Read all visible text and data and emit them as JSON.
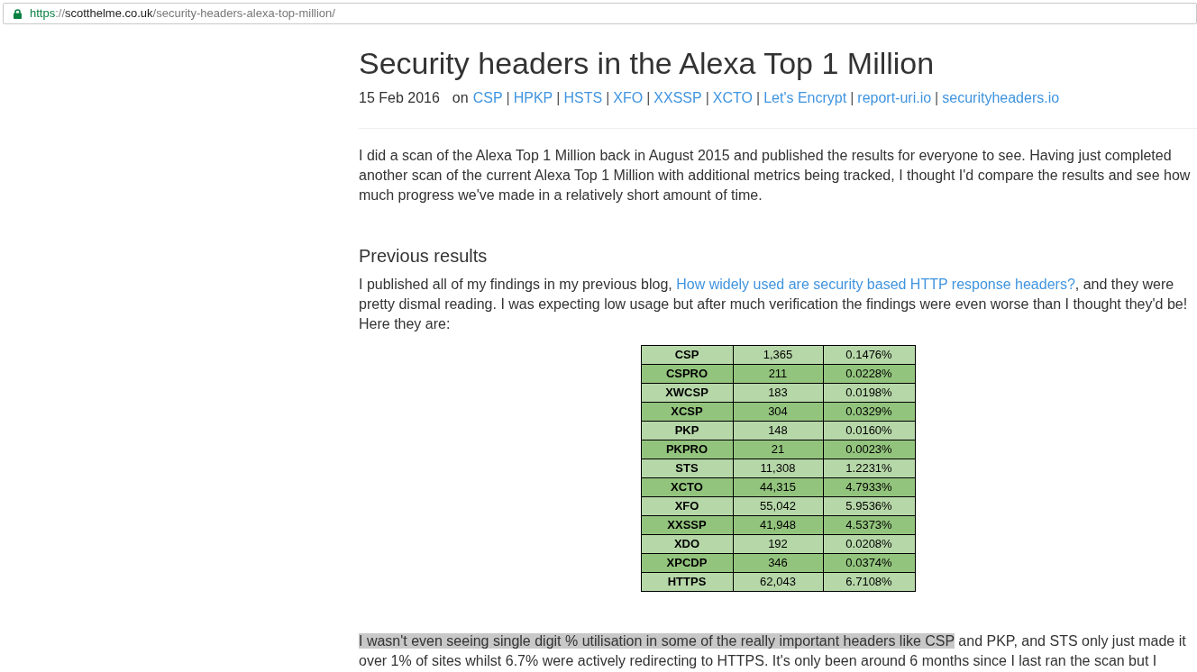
{
  "address_bar": {
    "scheme": "https",
    "separator": "://",
    "host": "scotthelme.co.uk",
    "path": "/security-headers-alexa-top-million/"
  },
  "article": {
    "title": "Security headers in the Alexa Top 1 Million",
    "meta": [
      {
        "kind": "date",
        "text": "15 Feb 2016"
      },
      {
        "kind": "text",
        "text": "on"
      },
      {
        "kind": "link",
        "text": "CSP"
      },
      {
        "kind": "separator",
        "text": "|"
      },
      {
        "kind": "link",
        "text": "HPKP"
      },
      {
        "kind": "separator",
        "text": "|"
      },
      {
        "kind": "link",
        "text": "HSTS"
      },
      {
        "kind": "separator",
        "text": "|"
      },
      {
        "kind": "link",
        "text": "XFO"
      },
      {
        "kind": "separator",
        "text": "|"
      },
      {
        "kind": "link",
        "text": "XXSSP"
      },
      {
        "kind": "separator",
        "text": "|"
      },
      {
        "kind": "link",
        "text": "XCTO"
      },
      {
        "kind": "separator",
        "text": "|"
      },
      {
        "kind": "link",
        "text": "Let's Encrypt"
      },
      {
        "kind": "separator",
        "text": "|"
      },
      {
        "kind": "link",
        "text": "report-uri.io"
      },
      {
        "kind": "separator",
        "text": "|"
      },
      {
        "kind": "link",
        "text": "securityheaders.io"
      }
    ],
    "intro": [
      {
        "kind": "text",
        "text": "I did a scan of the Alexa Top 1 Million back in August 2015 and published the results for everyone to see. Having just completed another scan of the current Alexa Top 1 Million with additional metrics being tracked, I thought I'd compare the results and see how much progress we've made in a relatively short amount of time."
      }
    ],
    "section": {
      "heading": "Previous results",
      "paragraph": [
        {
          "kind": "text",
          "text": "I published all of my findings in my previous blog, "
        },
        {
          "kind": "link",
          "text": "How widely used are security based HTTP response headers?"
        },
        {
          "kind": "text",
          "text": ", and they were pretty dismal reading. I was expecting low usage but after much verification the findings were even worse than I thought they'd be! Here they are:"
        }
      ],
      "table": {
        "rows": [
          {
            "column_1": "CSP",
            "column_2": "1,365",
            "column_3": "0.1476%"
          },
          {
            "column_1": "CSPRO",
            "column_2": "211",
            "column_3": "0.0228%"
          },
          {
            "column_1": "XWCSP",
            "column_2": "183",
            "column_3": "0.0198%"
          },
          {
            "column_1": "XCSP",
            "column_2": "304",
            "column_3": "0.0329%"
          },
          {
            "column_1": "PKP",
            "column_2": "148",
            "column_3": "0.0160%"
          },
          {
            "column_1": "PKPRO",
            "column_2": "21",
            "column_3": "0.0023%"
          },
          {
            "column_1": "STS",
            "column_2": "11,308",
            "column_3": "1.2231%"
          },
          {
            "column_1": "XCTO",
            "column_2": "44,315",
            "column_3": "4.7933%"
          },
          {
            "column_1": "XFO",
            "column_2": "55,042",
            "column_3": "5.9536%"
          },
          {
            "column_1": "XXSSP",
            "column_2": "41,948",
            "column_3": "4.5373%"
          },
          {
            "column_1": "XDO",
            "column_2": "192",
            "column_3": "0.0208%"
          },
          {
            "column_1": "XPCDP",
            "column_2": "346",
            "column_3": "0.0374%"
          },
          {
            "column_1": "HTTPS",
            "column_2": "62,043",
            "column_3": "6.7108%"
          }
        ]
      },
      "after_table": [
        {
          "kind": "highlight",
          "text": "I wasn't even seeing single digit % utilisation in some of the really important headers like CSP"
        },
        {
          "kind": "text",
          "text": " and PKP, and STS only just made it over 1% of sites whilst 6.7% were actively redirecting to HTTPS. It's only been around 6 months since I last ran the scan but I"
        }
      ]
    }
  }
}
